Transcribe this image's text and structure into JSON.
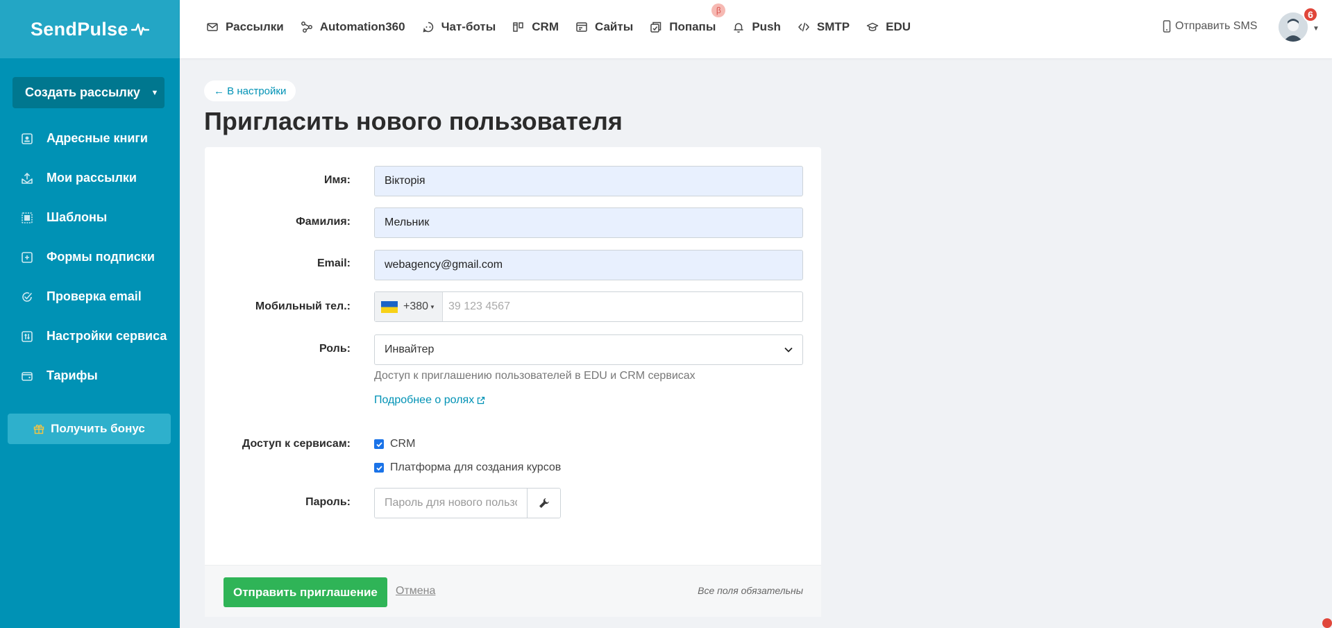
{
  "brand": {
    "name": "SendPulse",
    "accent": "#0092b5"
  },
  "sidebar": {
    "create_label": "Создать рассылку",
    "items": [
      {
        "label": "Адресные книги",
        "icon": "address-book-icon"
      },
      {
        "label": "Мои рассылки",
        "icon": "campaigns-icon"
      },
      {
        "label": "Шаблоны",
        "icon": "templates-icon"
      },
      {
        "label": "Формы подписки",
        "icon": "forms-icon"
      },
      {
        "label": "Проверка email",
        "icon": "check-email-icon"
      },
      {
        "label": "Настройки сервиса",
        "icon": "settings-icon"
      },
      {
        "label": "Тарифы",
        "icon": "wallet-icon"
      }
    ],
    "bonus_label": "Получить бонус"
  },
  "topnav": {
    "items": [
      {
        "label": "Рассылки",
        "icon": "mail-icon"
      },
      {
        "label": "Automation360",
        "icon": "automation-icon"
      },
      {
        "label": "Чат-боты",
        "icon": "chatbot-icon"
      },
      {
        "label": "CRM",
        "icon": "crm-icon"
      },
      {
        "label": "Сайты",
        "icon": "sites-icon"
      },
      {
        "label": "Попапы",
        "icon": "popups-icon",
        "badge": "β"
      },
      {
        "label": "Push",
        "icon": "bell-icon"
      },
      {
        "label": "SMTP",
        "icon": "code-icon"
      },
      {
        "label": "EDU",
        "icon": "graduation-cap-icon"
      }
    ],
    "sms_label": "Отправить SMS",
    "notifications": "6"
  },
  "page": {
    "back_label": "← В настройки",
    "title": "Пригласить нового пользователя"
  },
  "form": {
    "first_name": {
      "label": "Имя:",
      "value": "Вікторія"
    },
    "last_name": {
      "label": "Фамилия:",
      "value": "Мельник"
    },
    "email": {
      "label": "Email:",
      "value": "webagency@gmail.com"
    },
    "phone": {
      "label": "Мобильный тел.:",
      "code": "+380",
      "placeholder": "39 123 4567"
    },
    "role": {
      "label": "Роль:",
      "value": "Инвайтер",
      "hint": "Доступ к приглашению пользователей в EDU и CRM сервисах",
      "more_link": "Подробнее о ролях"
    },
    "services": {
      "label": "Доступ к сервисам:",
      "options": [
        {
          "label": "CRM",
          "checked": true
        },
        {
          "label": "Платформа для создания курсов",
          "checked": true
        }
      ]
    },
    "password": {
      "label": "Пароль:",
      "placeholder": "Пароль для нового пользователя"
    },
    "submit_label": "Отправить приглашение",
    "cancel_label": "Отмена",
    "required_note": "Все поля обязательны"
  }
}
